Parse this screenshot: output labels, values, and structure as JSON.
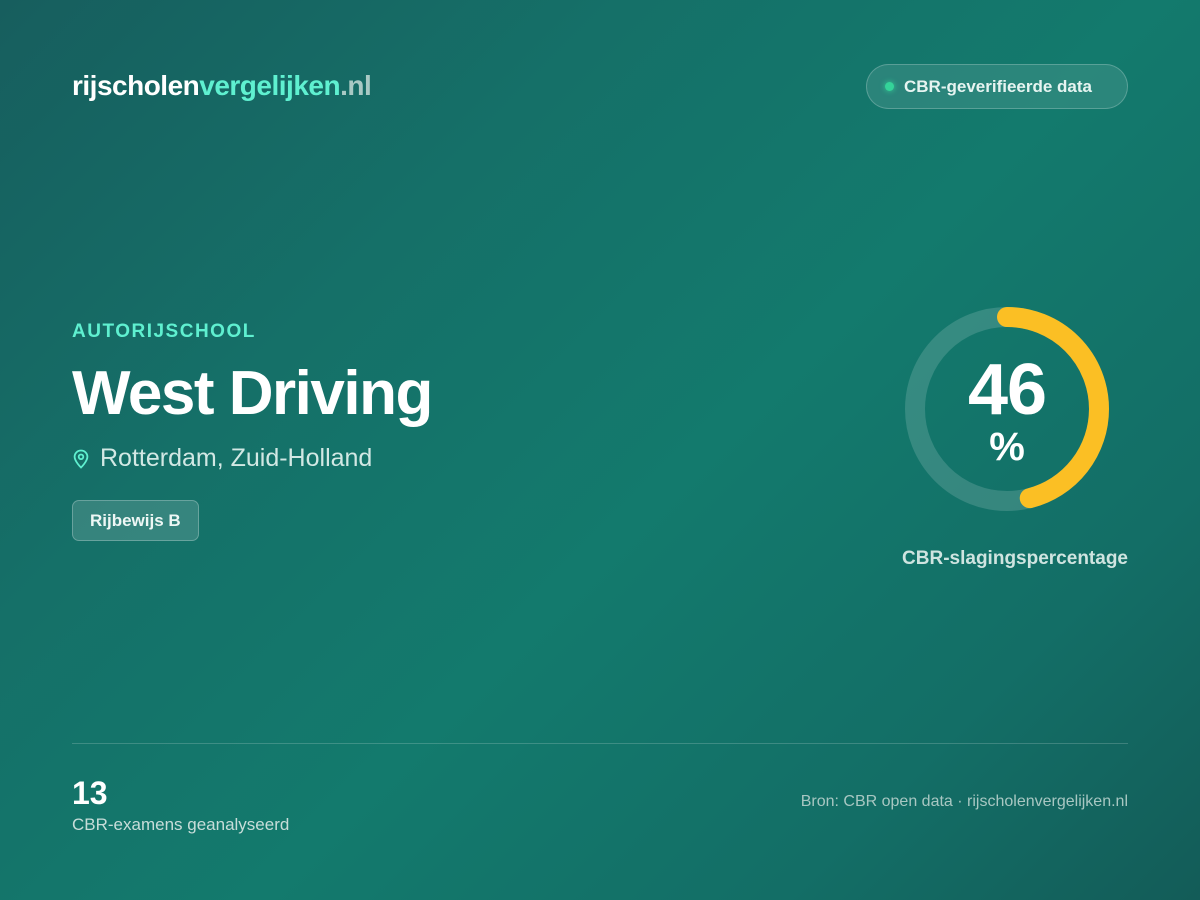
{
  "brand": {
    "part1": "rijscholen",
    "part2": "vergelijken",
    "part3": ".nl",
    "color_accent": "#5ff0d0"
  },
  "verified_badge": {
    "label": "CBR-geverifieerde data",
    "dot_color": "#34d399"
  },
  "school": {
    "category": "AUTORIJSCHOOL",
    "name": "West Driving",
    "location": "Rotterdam, Zuid-Holland",
    "location_icon": "map-pin-icon",
    "license": "Rijbewijs B"
  },
  "pass_rate": {
    "value": 46,
    "value_text": "46",
    "unit": "%",
    "label": "CBR-slagingspercentage",
    "fill_color": "#fbbf24",
    "track_color": "rgba(255,255,255,0.15)"
  },
  "stats": {
    "exams_count": "13",
    "exams_label": "CBR-examens geanalyseerd"
  },
  "footer": {
    "source": "Bron: CBR open data · rijscholenvergelijken.nl"
  }
}
